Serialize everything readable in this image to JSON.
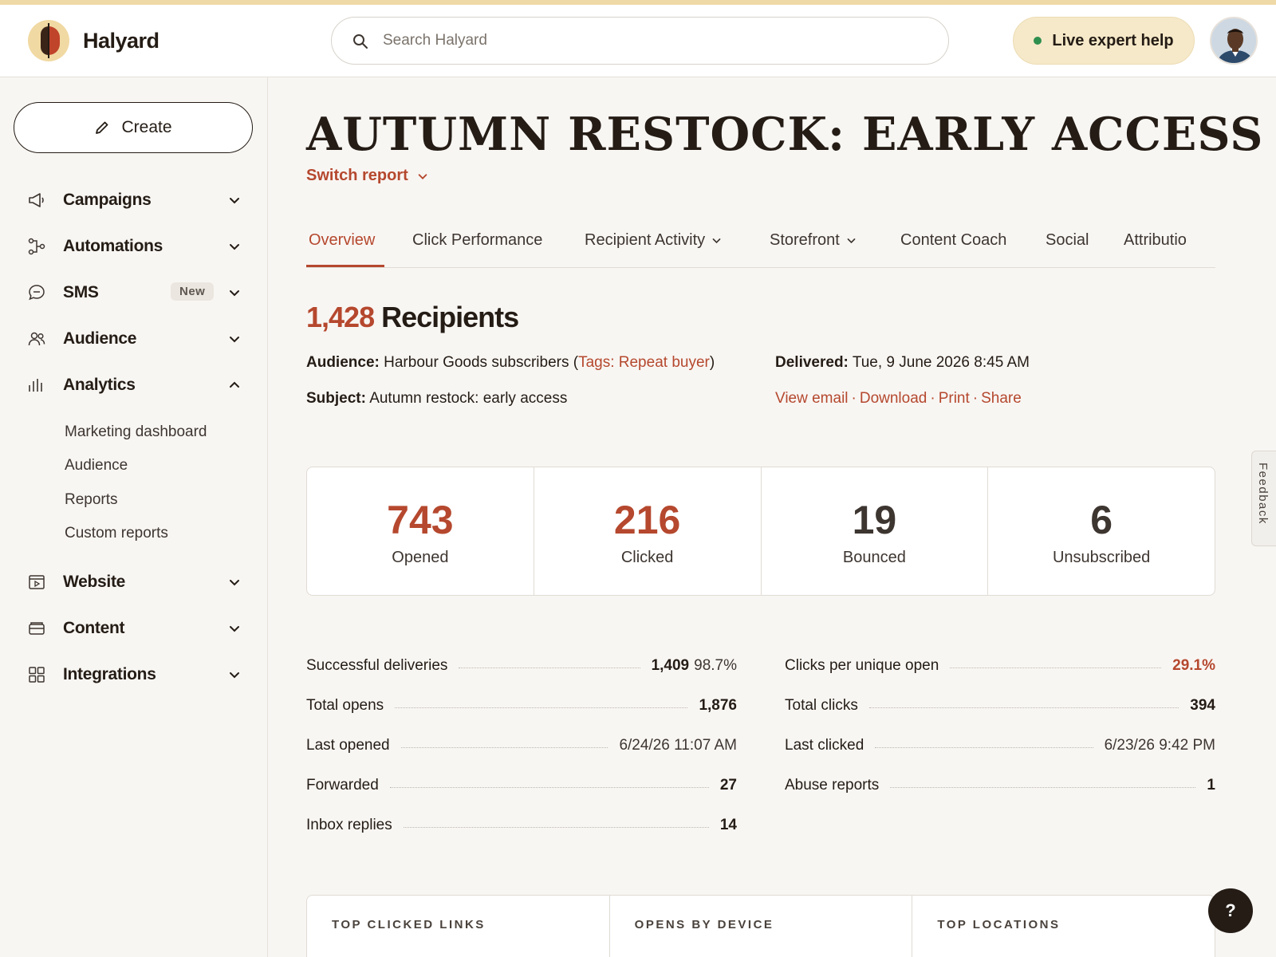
{
  "app": {
    "brand": "Halyard"
  },
  "header": {
    "search_placeholder": "Search Halyard",
    "expert_label": "Live expert help"
  },
  "sidebar": {
    "create_label": "Create",
    "items": [
      {
        "label": "Campaigns",
        "icon": "megaphone-icon"
      },
      {
        "label": "Automations",
        "icon": "workflow-icon"
      },
      {
        "label": "SMS",
        "icon": "chat-bubble-icon",
        "badge": "New"
      },
      {
        "label": "Audience",
        "icon": "people-icon"
      },
      {
        "label": "Analytics",
        "icon": "bar-chart-icon",
        "expanded": true
      },
      {
        "label": "Website",
        "icon": "browser-icon"
      },
      {
        "label": "Content",
        "icon": "folder-icon"
      },
      {
        "label": "Integrations",
        "icon": "grid-icon"
      }
    ],
    "analytics_sub": [
      "Marketing dashboard",
      "Audience",
      "Reports",
      "Custom reports"
    ]
  },
  "report": {
    "title": "AUTUMN RESTOCK: EARLY ACCESS",
    "switch_label": "Switch report",
    "tabs": [
      {
        "label": "Overview",
        "active": true
      },
      {
        "label": "Click Performance"
      },
      {
        "label": "Recipient Activity",
        "dropdown": true
      },
      {
        "label": "Storefront",
        "dropdown": true
      },
      {
        "label": "Content Coach"
      },
      {
        "label": "Social"
      },
      {
        "label": "Attributio"
      }
    ],
    "recipients_count": "1,428",
    "recipients_label": "Recipients",
    "audience_label": "Audience:",
    "audience_value": "Harbour Goods subscribers (",
    "audience_tag": "Tags: Repeat buyer",
    "audience_close": ")",
    "subject_label": "Subject:",
    "subject_value": "Autumn restock: early access",
    "delivered_label": "Delivered:",
    "delivered_value": "Tue, 9 June 2026 8:45 AM",
    "actions": [
      "View email",
      "Download",
      "Print",
      "Share"
    ],
    "stats": [
      {
        "value": "743",
        "label": "Opened"
      },
      {
        "value": "216",
        "label": "Clicked"
      },
      {
        "value": "19",
        "label": "Bounced"
      },
      {
        "value": "6",
        "label": "Unsubscribed"
      }
    ],
    "left_metrics": [
      {
        "label": "Successful deliveries",
        "value": "1,409",
        "extra": "98.7%"
      },
      {
        "label": "Total opens",
        "value": "1,876"
      },
      {
        "label": "Last opened",
        "value": "6/24/26 11:07 AM"
      },
      {
        "label": "Forwarded",
        "value": "27"
      },
      {
        "label": "Inbox replies",
        "value": "14"
      }
    ],
    "right_metrics": [
      {
        "label": "Clicks per unique open",
        "value": "29.1%"
      },
      {
        "label": "Total clicks",
        "value": "394"
      },
      {
        "label": "Last clicked",
        "value": "6/23/26 9:42 PM"
      },
      {
        "label": "Abuse reports",
        "value": "1"
      }
    ],
    "cards": [
      "TOP CLICKED LINKS",
      "OPENS BY DEVICE",
      "TOP LOCATIONS"
    ]
  },
  "feedback_label": "Feedback",
  "help_label": "?",
  "colors": {
    "accent": "#b5482e",
    "brand_yellow": "#f1d9a3",
    "online": "#2f8f4e"
  }
}
